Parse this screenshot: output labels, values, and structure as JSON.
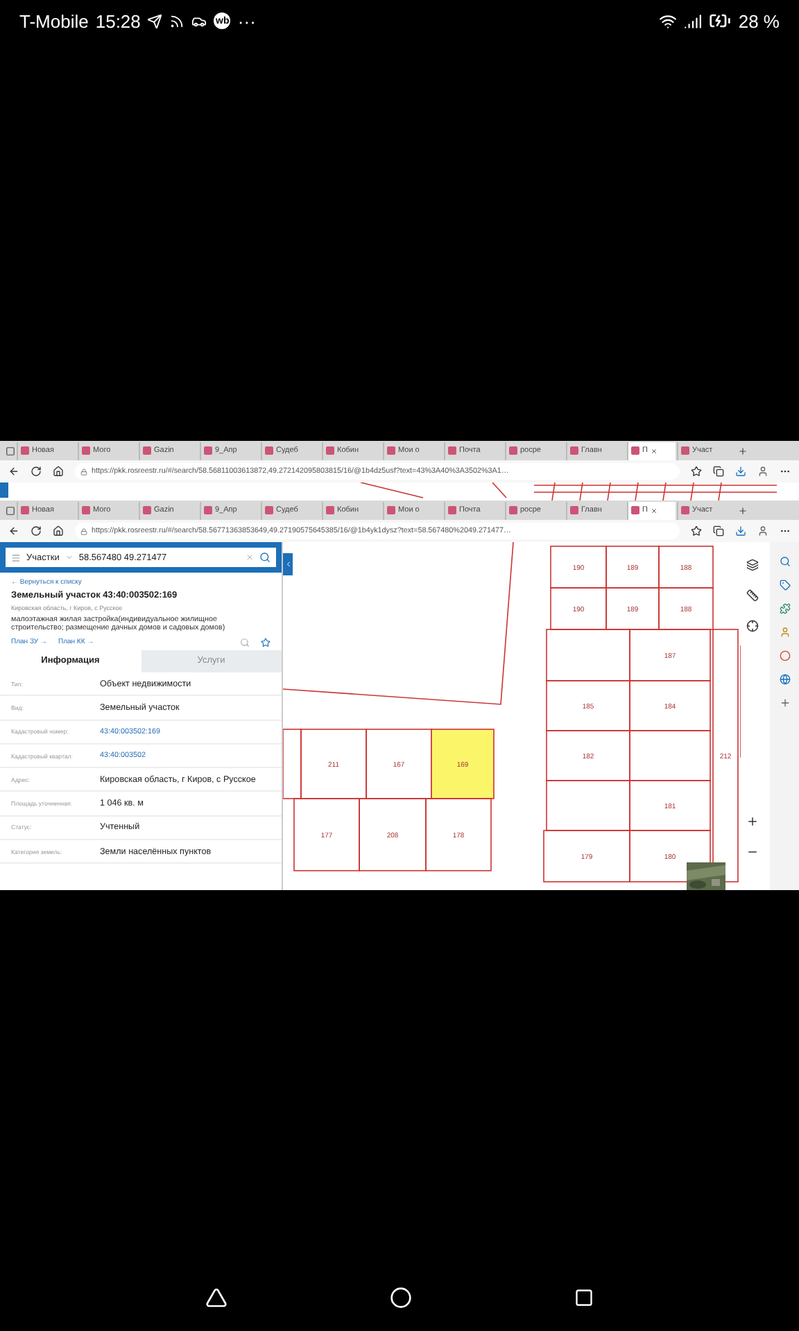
{
  "status_bar": {
    "carrier": "T-Mobile",
    "time": "15:28",
    "badge": "wb",
    "more": "···",
    "battery": "28 %"
  },
  "browser_windows": [
    {
      "tabs": [
        {
          "label": "Новая",
          "selected": false
        },
        {
          "label": "Мого",
          "selected": false
        },
        {
          "label": "Gazin",
          "selected": false
        },
        {
          "label": "9_Апр",
          "selected": false
        },
        {
          "label": "Судеб",
          "selected": false
        },
        {
          "label": "Кобин",
          "selected": false
        },
        {
          "label": "Мои о",
          "selected": false
        },
        {
          "label": "Почта",
          "selected": false
        },
        {
          "label": "росре",
          "selected": false
        },
        {
          "label": "Главн",
          "selected": false
        },
        {
          "label": "П",
          "selected": true
        },
        {
          "label": "Участ",
          "selected": false
        }
      ],
      "url": "https://pkk.rosreestr.ru/#/search/58.56811003613872,49.272142095803815/16/@1b4dz5usf?text=43%3A40%3A3502%3A1…"
    },
    {
      "tabs": [
        {
          "label": "Новая",
          "selected": false
        },
        {
          "label": "Мого",
          "selected": false
        },
        {
          "label": "Gazin",
          "selected": false
        },
        {
          "label": "9_Апр",
          "selected": false
        },
        {
          "label": "Судеб",
          "selected": false
        },
        {
          "label": "Кобин",
          "selected": false
        },
        {
          "label": "Мои о",
          "selected": false
        },
        {
          "label": "Почта",
          "selected": false
        },
        {
          "label": "росре",
          "selected": false
        },
        {
          "label": "Главн",
          "selected": false
        },
        {
          "label": "П",
          "selected": true
        },
        {
          "label": "Участ",
          "selected": false
        }
      ],
      "url": "https://pkk.rosreestr.ru/#/search/58.56771363853649,49.27190575645385/16/@1b4yk1dysz?text=58.567480%2049.271477…"
    }
  ],
  "panel": {
    "search": {
      "category": "Участки",
      "value": "58.567480 49.271477"
    },
    "back_link": "← Вернуться к списку",
    "title": "Земельный участок 43:40:003502:169",
    "address": "Кировская область, г Киров, с Русское",
    "usage": "малоэтажная жилая застройка(индивидуальное жилищное строительство; размещение дачных домов и садовых домов)",
    "links": [
      "План ЗУ →",
      "План КК →"
    ],
    "tabs": [
      {
        "label": "Информация",
        "selected": true
      },
      {
        "label": "Услуги",
        "selected": false
      }
    ],
    "rows": [
      {
        "label": "Тип:",
        "value": "Объект недвижимости",
        "kind": "text"
      },
      {
        "label": "Вид:",
        "value": "Земельный участок",
        "kind": "text"
      },
      {
        "label": "Кадастровый номер:",
        "value": "43:40:003502:169",
        "kind": "link"
      },
      {
        "label": "Кадастровый квартал:",
        "value": "43:40:003502",
        "kind": "link"
      },
      {
        "label": "Адрес:",
        "value": "Кировская область, г Киров, с Русское",
        "kind": "text"
      },
      {
        "label": "Площадь уточненная:",
        "value": "1 046 кв. м",
        "kind": "text"
      },
      {
        "label": "Статус:",
        "value": "Учтенный",
        "kind": "text"
      },
      {
        "label": "Категория земель:",
        "value": "Земли населённых пунктов",
        "kind": "text"
      }
    ]
  },
  "map": {
    "parcels": [
      {
        "label": "190",
        "selected": false
      },
      {
        "label": "189",
        "selected": false
      },
      {
        "label": "188",
        "selected": false
      },
      {
        "label": "190",
        "selected": false
      },
      {
        "label": "189",
        "selected": false
      },
      {
        "label": "188",
        "selected": false
      },
      {
        "label": "187",
        "selected": false
      },
      {
        "label": "185",
        "selected": false
      },
      {
        "label": "184",
        "selected": false
      },
      {
        "label": "182",
        "selected": false
      },
      {
        "label": "181",
        "selected": false
      },
      {
        "label": "179",
        "selected": false
      },
      {
        "label": "180",
        "selected": false
      },
      {
        "label": "212",
        "selected": false
      },
      {
        "label": "211",
        "selected": false
      },
      {
        "label": "167",
        "selected": false
      },
      {
        "label": "169",
        "selected": true
      },
      {
        "label": "177",
        "selected": false
      },
      {
        "label": "208",
        "selected": false
      },
      {
        "label": "178",
        "selected": false
      }
    ]
  }
}
